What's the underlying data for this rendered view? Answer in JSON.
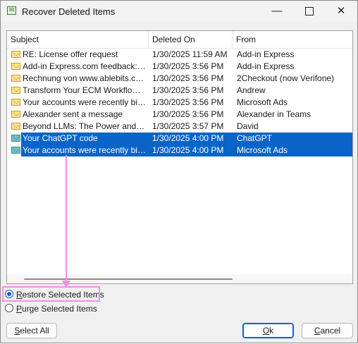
{
  "window": {
    "title": "Recover Deleted Items",
    "minimize_glyph": "—",
    "close_glyph": "✕"
  },
  "columns": {
    "subject": "Subject",
    "deleted_on": "Deleted On",
    "from": "From"
  },
  "rows": [
    {
      "subject": "RE: License offer request",
      "deleted_on": "1/30/2025 11:59 AM",
      "from": "Add-in Express",
      "selected": false
    },
    {
      "subject": "Add-in Express.com feedback: Cu...",
      "deleted_on": "1/30/2025 3:56 PM",
      "from": "Add-in Express",
      "selected": false
    },
    {
      "subject": "Rechnung von www.ablebits.com",
      "deleted_on": "1/30/2025 3:56 PM",
      "from": "2Checkout (now Verifone)",
      "selected": false
    },
    {
      "subject": "Transform Your ECM Workflows wi...",
      "deleted_on": "1/30/2025 3:56 PM",
      "from": "Andrew",
      "selected": false
    },
    {
      "subject": "Your accounts were recently billed",
      "deleted_on": "1/30/2025 3:56 PM",
      "from": "Microsoft Ads",
      "selected": false
    },
    {
      "subject": "Alexander sent a message",
      "deleted_on": "1/30/2025 3:56 PM",
      "from": "Alexander  in Teams",
      "selected": false
    },
    {
      "subject": "Beyond LLMs: The Power and Pitf...",
      "deleted_on": "1/30/2025 3:57 PM",
      "from": "David",
      "selected": false
    },
    {
      "subject": "Your ChatGPT code",
      "deleted_on": "1/30/2025 4:00 PM",
      "from": "ChatGPT",
      "selected": true
    },
    {
      "subject": "Your accounts were recently billed",
      "deleted_on": "1/30/2025 4:00 PM",
      "from": "Microsoft Ads",
      "selected": true
    }
  ],
  "options": {
    "restore": {
      "prefix": "",
      "accel": "R",
      "rest": "estore Selected Items",
      "checked": true
    },
    "purge": {
      "prefix": "",
      "accel": "P",
      "rest": "urge Selected Items",
      "checked": false
    }
  },
  "buttons": {
    "select_all": {
      "prefix": "",
      "accel": "S",
      "rest": "elect All"
    },
    "ok": {
      "prefix": "",
      "accel": "O",
      "rest": "k"
    },
    "cancel": {
      "prefix": "",
      "accel": "C",
      "rest": "ancel"
    }
  },
  "colors": {
    "selection": "#0a64c8",
    "annotation": "#f08ee8"
  },
  "icons": {
    "app": "recover-items-icon",
    "row": "envelope-icon"
  }
}
